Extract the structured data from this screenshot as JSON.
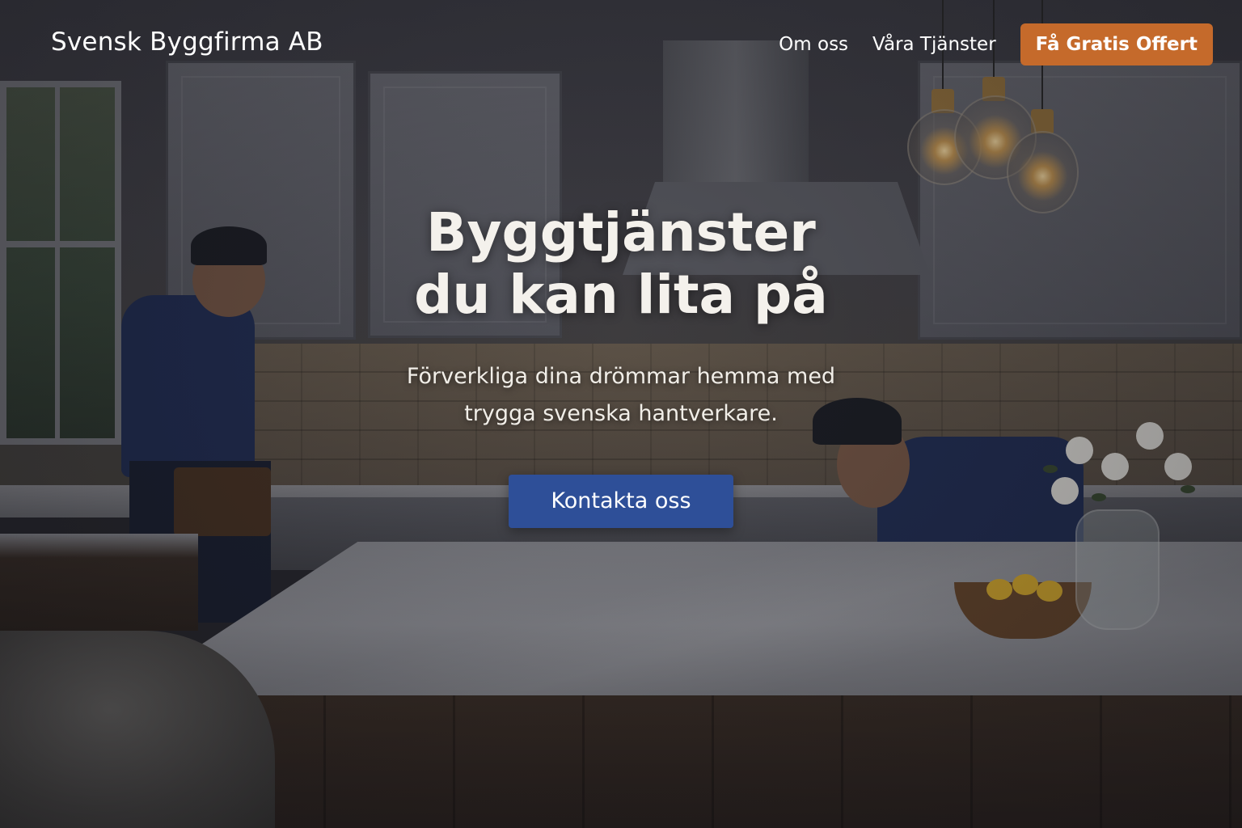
{
  "header": {
    "brand": "Svensk Byggfirma AB",
    "nav": {
      "about": "Om oss",
      "services": "Våra Tjänster",
      "quote_button": "Få Gratis Offert"
    }
  },
  "hero": {
    "title_line1": "Byggtjänster",
    "title_line2": "du kan lita på",
    "subtitle_line1": "Förverkliga dina drömmar hemma med",
    "subtitle_line2": "trygga svenska hantverkare.",
    "button": "Kontakta oss"
  },
  "background_image": "hero-photo-kitchen-renovation-workers",
  "colors": {
    "quote_button": "#c56a2b",
    "contact_button": "#2e4f98",
    "text": "#ffffff"
  }
}
